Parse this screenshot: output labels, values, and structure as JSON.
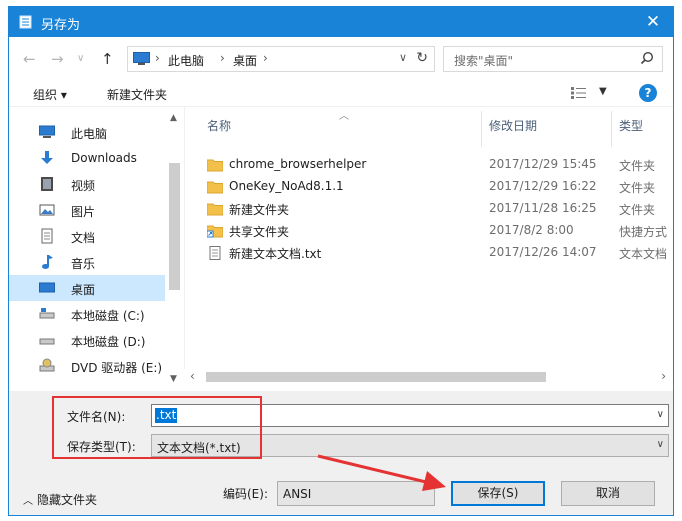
{
  "window": {
    "title": "另存为",
    "close_symbol": "✕"
  },
  "nav": {
    "breadcrumbs": [
      "此电脑",
      "桌面"
    ],
    "search_placeholder": "搜索\"桌面\""
  },
  "toolbar": {
    "organize": "组织 ▾",
    "new_folder": "新建文件夹",
    "help": "?"
  },
  "sidebar": {
    "items": [
      {
        "label": "此电脑",
        "icon": "pc-icon"
      },
      {
        "label": "Downloads",
        "icon": "download-icon"
      },
      {
        "label": "视频",
        "icon": "video-icon"
      },
      {
        "label": "图片",
        "icon": "picture-icon"
      },
      {
        "label": "文档",
        "icon": "document-icon"
      },
      {
        "label": "音乐",
        "icon": "music-icon"
      },
      {
        "label": "桌面",
        "icon": "desktop-icon",
        "selected": true
      },
      {
        "label": "本地磁盘 (C:)",
        "icon": "drive-icon"
      },
      {
        "label": "本地磁盘 (D:)",
        "icon": "drive-icon"
      },
      {
        "label": "DVD 驱动器 (E:)",
        "icon": "dvd-icon"
      }
    ]
  },
  "columns": {
    "name": "名称",
    "date": "修改日期",
    "type": "类型"
  },
  "files": [
    {
      "name": "chrome_browserhelper",
      "date": "2017/12/29 15:45",
      "type": "文件夹",
      "icon": "folder-icon"
    },
    {
      "name": "OneKey_NoAd8.1.1",
      "date": "2017/12/29 16:22",
      "type": "文件夹",
      "icon": "folder-icon"
    },
    {
      "name": "新建文件夹",
      "date": "2017/11/28 16:25",
      "type": "文件夹",
      "icon": "folder-icon"
    },
    {
      "name": "共享文件夹",
      "date": "2017/8/2 8:00",
      "type": "快捷方式",
      "icon": "shortcut-folder-icon"
    },
    {
      "name": "新建文本文档.txt",
      "date": "2017/12/26 14:07",
      "type": "文本文档",
      "icon": "text-file-icon"
    }
  ],
  "form": {
    "filename_label": "文件名(N):",
    "filename_value": ".txt",
    "filetype_label": "保存类型(T):",
    "filetype_value": "文本文档(*.txt)",
    "hide_folders": "隐藏文件夹",
    "encoding_label": "编码(E):",
    "encoding_value": "ANSI",
    "save_button": "保存(S)",
    "cancel_button": "取消"
  },
  "colors": {
    "accent": "#1883d7",
    "annotation": "#e53333",
    "selection": "#cce8ff"
  }
}
